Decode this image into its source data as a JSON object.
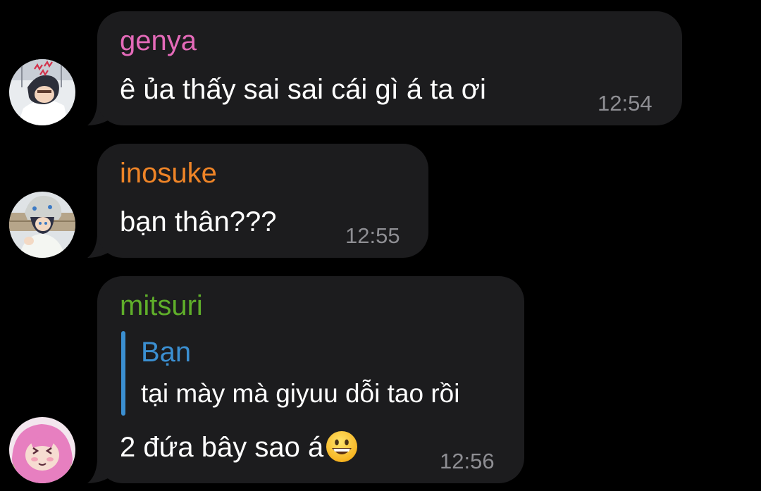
{
  "messages": [
    {
      "sender": "genya",
      "sender_color": "#e46ab9",
      "text": "ê ủa thấy sai sai cái gì á ta ơi",
      "time": "12:54",
      "avatar_icon": "genya-avatar-icon"
    },
    {
      "sender": "inosuke",
      "sender_color": "#ee8427",
      "text": "bạn thân???",
      "time": "12:55",
      "avatar_icon": "inosuke-avatar-icon"
    },
    {
      "sender": "mitsuri",
      "sender_color": "#5fae2a",
      "reply": {
        "sender": "Bạn",
        "sender_color": "#3b8fd1",
        "text": "tại mày mà giyuu dỗi tao rồi"
      },
      "text": "2 đứa bây sao á",
      "emoji": "grinning-face-icon",
      "time": "12:56",
      "avatar_icon": "mitsuri-avatar-icon"
    }
  ]
}
